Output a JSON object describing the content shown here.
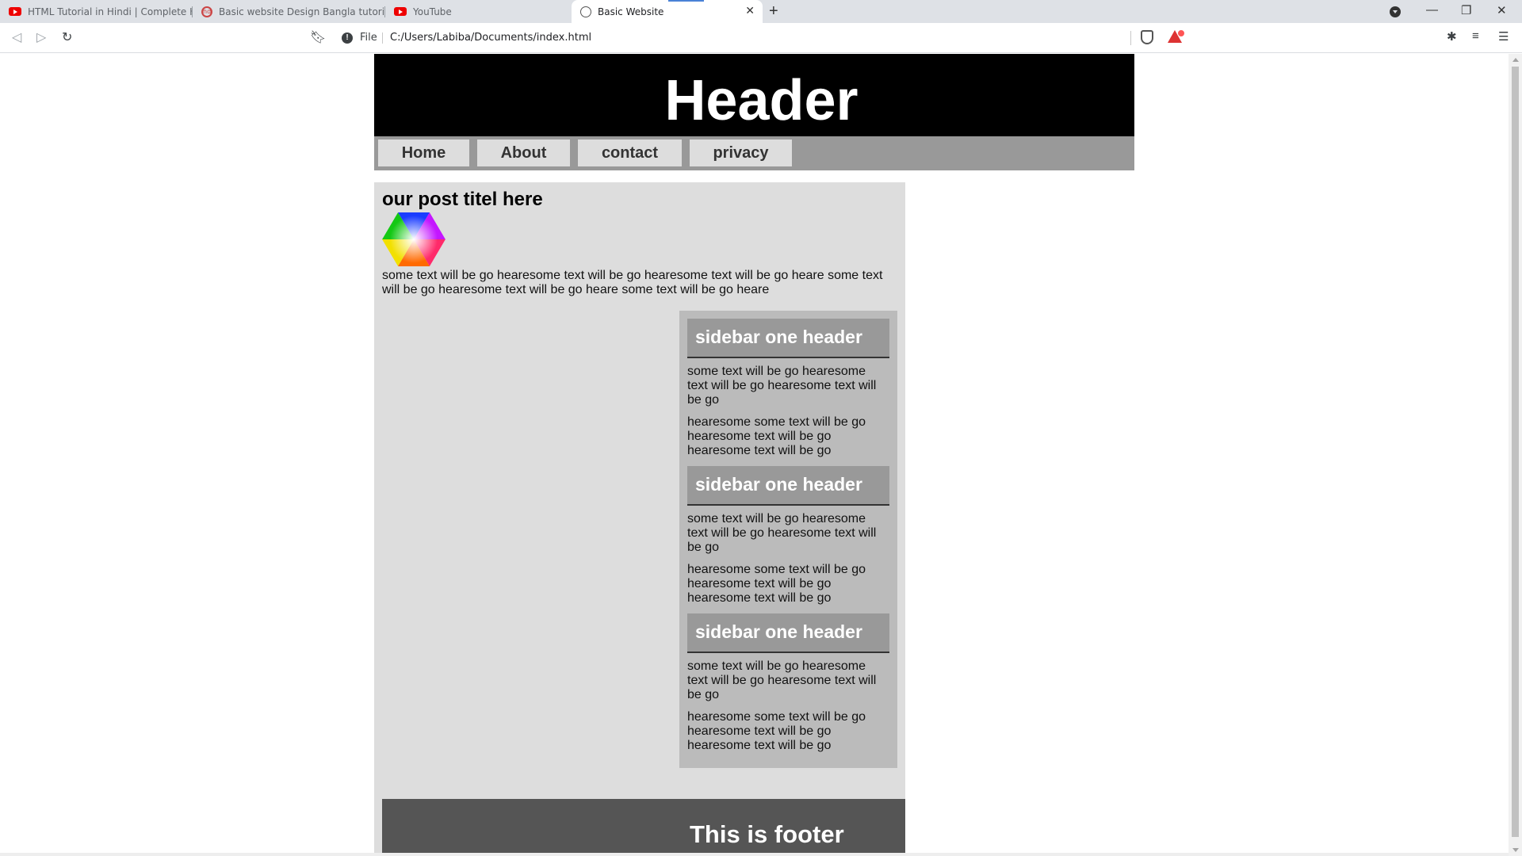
{
  "browser": {
    "tabs": [
      {
        "title": "HTML Tutorial in Hindi | Complete HTML",
        "icon": "youtube-icon"
      },
      {
        "title": "Basic website Design Bangla tutorial (",
        "icon": "site-favicon-icon"
      },
      {
        "title": "YouTube",
        "icon": "youtube-icon"
      },
      {
        "title": "Basic Website",
        "icon": "globe-icon",
        "close": "✕"
      }
    ],
    "new_tab": "+",
    "address": {
      "scheme_label": "File",
      "url": "C:/Users/Labiba/Documents/index.html"
    }
  },
  "site": {
    "header_title": "Header",
    "nav": [
      "Home",
      "About",
      "contact",
      "privacy"
    ],
    "post": {
      "title": "our post titel here",
      "body": "some text will be go hearesome text will be go hearesome text will be go heare some text will be go hearesome text will be go heare some text will be go heare"
    },
    "sidebar": [
      {
        "header": "sidebar one header",
        "p1": "some text will be go hearesome text will be go hearesome text will be go",
        "p2": "hearesome some text will be go hearesome text will be go hearesome text will be go"
      },
      {
        "header": "sidebar one header",
        "p1": "some text will be go hearesome text will be go hearesome text will be go",
        "p2": "hearesome some text will be go hearesome text will be go hearesome text will be go"
      },
      {
        "header": "sidebar one header",
        "p1": "some text will be go hearesome text will be go hearesome text will be go",
        "p2": "hearesome some text will be go hearesome text will be go hearesome text will be go"
      }
    ],
    "footer": "This is footer"
  }
}
